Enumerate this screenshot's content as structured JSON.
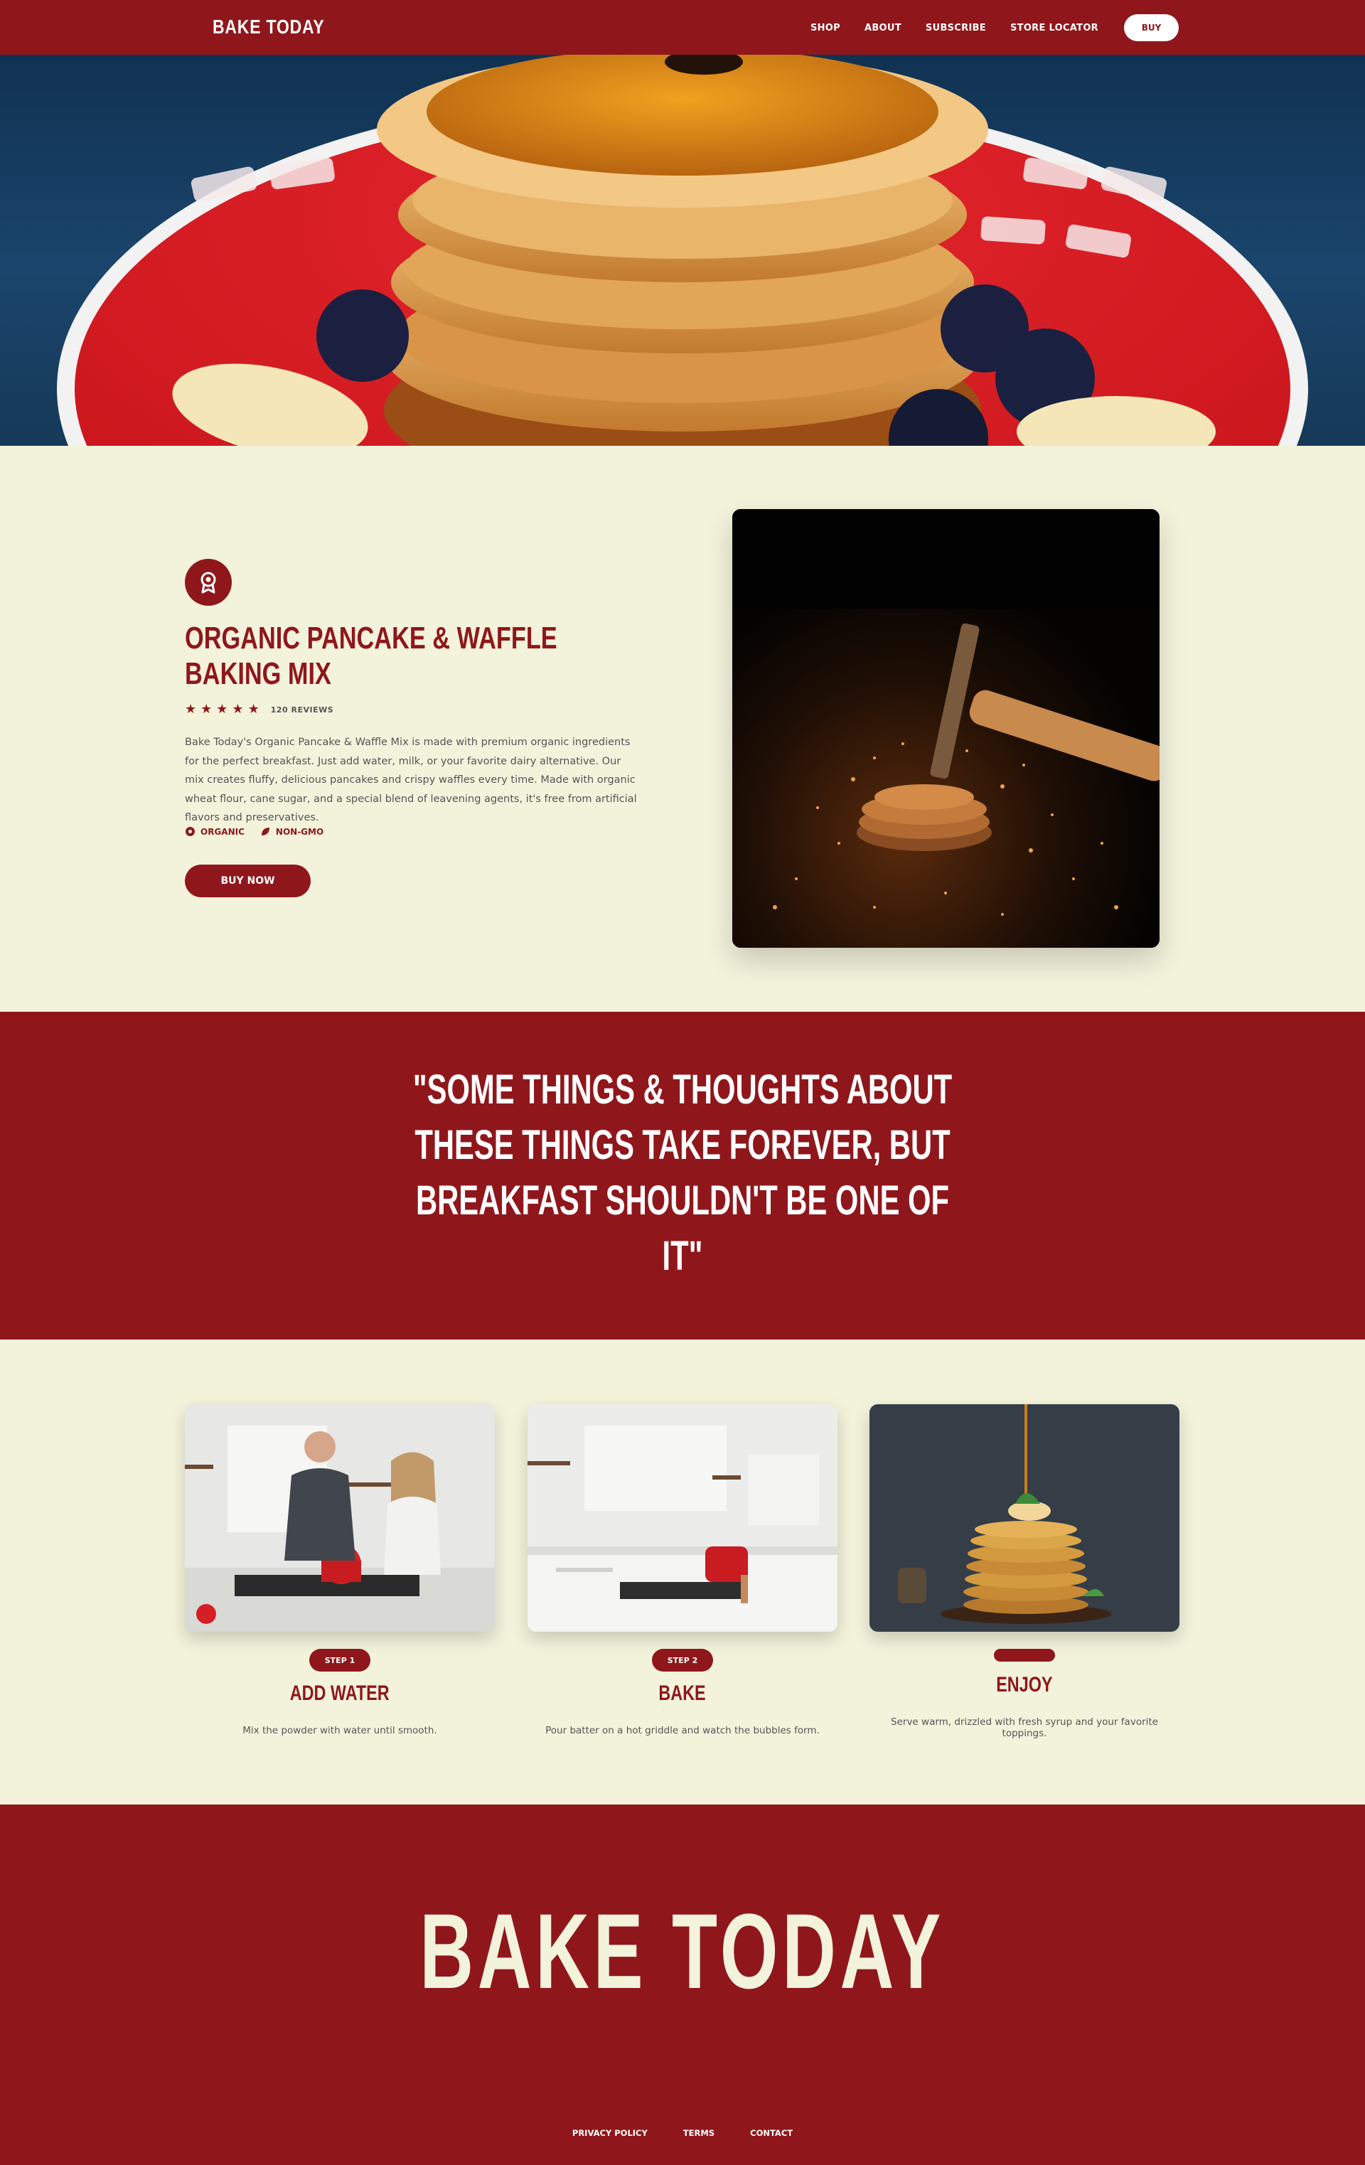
{
  "nav": {
    "logo": "BAKE TODAY",
    "links": [
      "SHOP",
      "ABOUT",
      "SUBSCRIBE",
      "STORE LOCATOR"
    ],
    "buy_label": "BUY"
  },
  "product": {
    "badge_icon": "award-ribbon-icon",
    "title": "ORGANIC PANCAKE & WAFFLE BAKING MIX",
    "rating_stars": 5,
    "reviews": "120 REVIEWS",
    "description": "Bake Today's Organic Pancake & Waffle Mix is made with premium organic ingredients for the perfect breakfast. Just add water, milk, or your favorite dairy alternative. Our mix creates fluffy, delicious pancakes and crispy waffles every time. Made with organic wheat flour, cane sugar, and a special blend of leavening agents, it's free from artificial flavors and preservatives.",
    "tags": [
      {
        "label": "ORGANIC",
        "icon": "dot-icon"
      },
      {
        "label": "NON-GMO",
        "icon": "leaf-icon"
      }
    ],
    "buy_now_label": "BUY NOW"
  },
  "quote": {
    "text": "\"SOME THINGS & THOUGHTS ABOUT THESE THINGS TAKE FOREVER, BUT BREAKFAST SHOULDN'T BE ONE OF IT\""
  },
  "steps": [
    {
      "pill": "STEP 1",
      "title": "ADD WATER",
      "desc": "Mix the powder with water until smooth."
    },
    {
      "pill": "STEP 2",
      "title": "BAKE",
      "desc": "Pour batter on a hot griddle and watch the bubbles form."
    },
    {
      "pill": "",
      "title": "ENJOY",
      "desc": "Serve warm, drizzled with fresh syrup and your favorite toppings."
    }
  ],
  "footer": {
    "brand": "BAKE TODAY",
    "links": [
      "PRIVACY POLICY",
      "TERMS",
      "CONTACT"
    ]
  },
  "colors": {
    "brand_red": "#8f171b",
    "cream": "#f3f3dc"
  }
}
